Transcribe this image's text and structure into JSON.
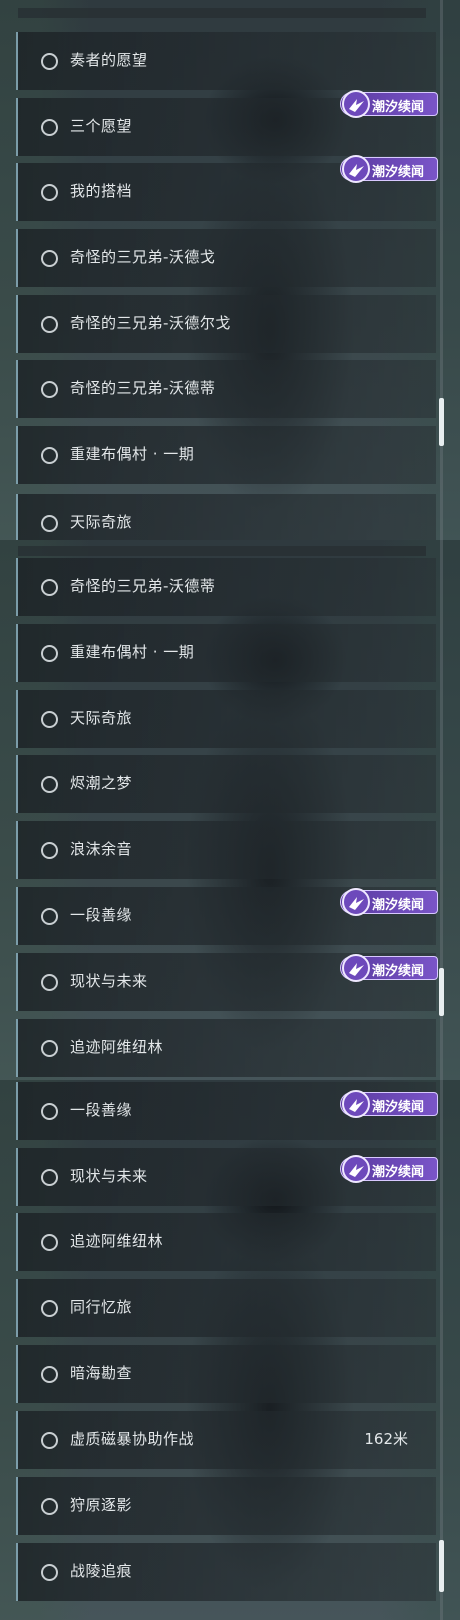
{
  "badge_text": "潮汐续闻",
  "panel1": {
    "items": [
      {
        "label": "奏者的愿望"
      },
      {
        "label": "三个愿望"
      },
      {
        "label": "我的搭档"
      },
      {
        "label": "奇怪的三兄弟-沃德戈"
      },
      {
        "label": "奇怪的三兄弟-沃德尔戈"
      },
      {
        "label": "奇怪的三兄弟-沃德蒂"
      },
      {
        "label": "重建布偶村 · 一期"
      },
      {
        "label": "天际奇旅"
      }
    ]
  },
  "panel2": {
    "items": [
      {
        "label": "奇怪的三兄弟-沃德蒂"
      },
      {
        "label": "重建布偶村 · 一期"
      },
      {
        "label": "天际奇旅"
      },
      {
        "label": "烬潮之梦"
      },
      {
        "label": "浪沫余音"
      },
      {
        "label": "一段善缘"
      },
      {
        "label": "现状与未来"
      },
      {
        "label": "追迹阿维纽林"
      }
    ]
  },
  "panel3": {
    "items": [
      {
        "label": "一段善缘"
      },
      {
        "label": "现状与未来"
      },
      {
        "label": "追迹阿维纽林"
      },
      {
        "label": "同行忆旅"
      },
      {
        "label": "暗海勘查"
      },
      {
        "label": "虚质磁暴协助作战",
        "distance": "162米"
      },
      {
        "label": "狩原逐影"
      },
      {
        "label": "战陵追痕"
      }
    ]
  }
}
